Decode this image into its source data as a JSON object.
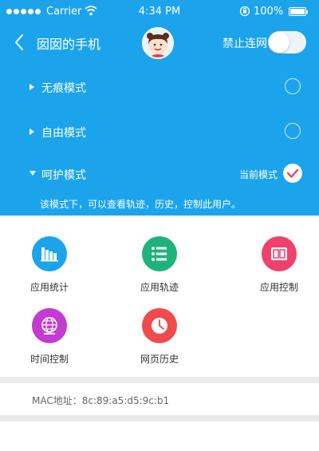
{
  "status_bar": {
    "carrier": "Carrier",
    "time": "4:34 PM",
    "battery": "100%"
  },
  "header": {
    "title": "囡囡的手机",
    "block_label": "禁止连网",
    "block_toggle_on": false
  },
  "modes": [
    {
      "label": "无痕模式",
      "selected": false
    },
    {
      "label": "自由模式",
      "selected": false
    },
    {
      "label": "呵护模式",
      "selected": true,
      "current_label": "当前模式"
    }
  ],
  "mode_description": "该模式下，可以查看轨迹，历史，控制此用户。",
  "tiles": [
    {
      "label": "应用统计",
      "color": "#1ba4ec",
      "icon": "bar-chart-icon"
    },
    {
      "label": "应用轨迹",
      "color": "#1fb37b",
      "icon": "list-icon"
    },
    {
      "label": "应用控制",
      "color": "#f0416c",
      "icon": "app-window-icon"
    },
    {
      "label": "时间控制",
      "color": "#c43bd2",
      "icon": "globe-icon"
    },
    {
      "label": "网页历史",
      "color": "#ef4b4b",
      "icon": "clock-icon"
    }
  ],
  "mac": "MAC地址：8c:89:a5:d5:9c:b1",
  "colors": {
    "header_bg": "#1ba4ec",
    "check": "#f0416c"
  }
}
